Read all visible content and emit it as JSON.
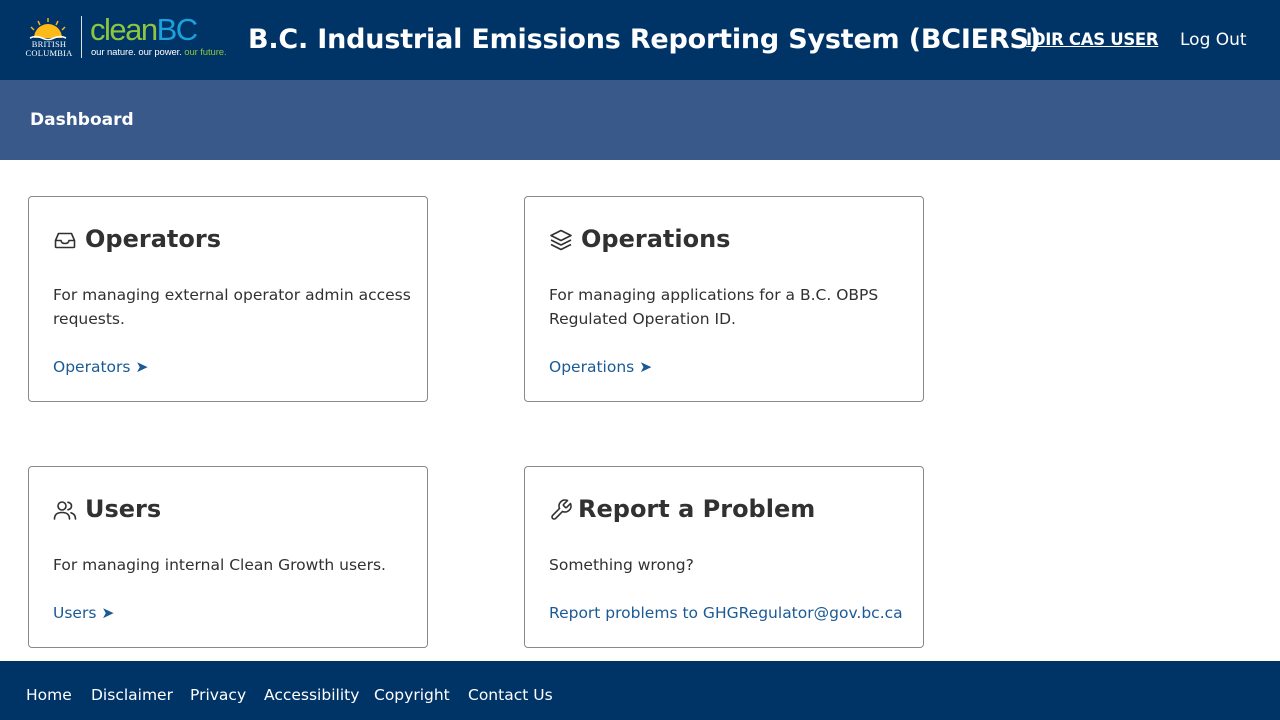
{
  "header": {
    "logo": {
      "bc_line1": "BRITISH",
      "bc_line2": "COLUMBIA",
      "cleanbc_part1": "clean",
      "cleanbc_part2": "BC",
      "tagline_main": "our nature. our power. ",
      "tagline_accent": "our future."
    },
    "title": "B.C. Industrial Emissions Reporting System (BCIERS)",
    "user": "IDIR CAS USER",
    "logout": "Log Out"
  },
  "subnav": {
    "title": "Dashboard"
  },
  "cards": [
    {
      "icon": "inbox-icon",
      "title": "Operators",
      "description": "For managing external operator admin access requests.",
      "link": "Operators ➤"
    },
    {
      "icon": "layers-icon",
      "title": "Operations",
      "description": "For managing applications for a B.C. OBPS Regulated Operation ID.",
      "link": "Operations ➤"
    },
    {
      "icon": "users-icon",
      "title": "Users",
      "description": "For managing internal Clean Growth users.",
      "link": "Users ➤"
    },
    {
      "icon": "wrench-icon",
      "title": "Report a Problem",
      "description": "Something wrong?",
      "link": "Report problems to GHGRegulator@gov.bc.ca"
    }
  ],
  "footer": {
    "links": [
      "Home",
      "Disclaimer",
      "Privacy",
      "Accessibility",
      "Copyright",
      "Contact Us"
    ]
  },
  "colors": {
    "header_bg": "#003366",
    "subnav_bg": "#38598a",
    "link": "#1a5a96",
    "clean_green": "#8cc63f",
    "bc_blue": "#1ba1dc"
  }
}
